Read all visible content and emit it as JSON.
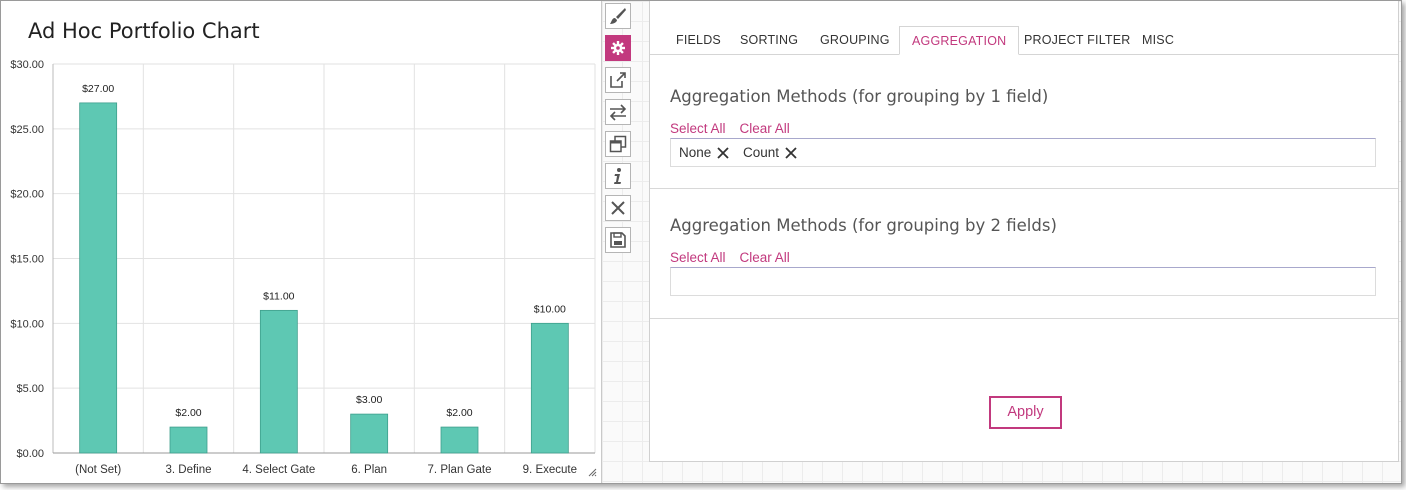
{
  "chart": {
    "title": "Ad Hoc Portfolio Chart"
  },
  "chart_data": {
    "type": "bar",
    "categories": [
      "(Not Set)",
      "3. Define",
      "4. Select Gate",
      "6. Plan",
      "7. Plan Gate",
      "9. Execute"
    ],
    "values": [
      27,
      2,
      11,
      3,
      2,
      10
    ],
    "data_labels": [
      "$27.00",
      "$2.00",
      "$11.00",
      "$3.00",
      "$2.00",
      "$10.00"
    ],
    "y_ticks": [
      "$0.00",
      "$5.00",
      "$10.00",
      "$15.00",
      "$20.00",
      "$25.00",
      "$30.00"
    ],
    "ylim": [
      0,
      30
    ],
    "title": "Ad Hoc Portfolio Chart",
    "xlabel": "",
    "ylabel": "",
    "grid": true,
    "bar_color": "#5ec8b3"
  },
  "toolbar": {
    "items": [
      {
        "icon": "brush-icon",
        "active": false
      },
      {
        "icon": "gear-icon",
        "active": true
      },
      {
        "icon": "external-link-icon",
        "active": false
      },
      {
        "icon": "swap-icon",
        "active": false
      },
      {
        "icon": "copy-icon",
        "active": false
      },
      {
        "icon": "info-icon",
        "active": false
      },
      {
        "icon": "close-icon",
        "active": false
      },
      {
        "icon": "save-icon",
        "active": false
      }
    ]
  },
  "tabs": {
    "fields": "FIELDS",
    "sorting": "SORTING",
    "grouping": "GROUPING",
    "aggregation": "AGGREGATION",
    "project_filter": "PROJECT FILTER",
    "misc": "MISC",
    "active": "aggregation"
  },
  "aggregation": {
    "section1": {
      "title": "Aggregation Methods (for grouping by 1 field)",
      "select_all": "Select All",
      "clear_all": "Clear All",
      "tags": [
        "None",
        "Count"
      ]
    },
    "section2": {
      "title": "Aggregation Methods (for grouping by 2 fields)",
      "select_all": "Select All",
      "clear_all": "Clear All",
      "tags": []
    }
  },
  "apply_label": "Apply",
  "colors": {
    "accent": "#c2397e",
    "bar": "#5ec8b3"
  }
}
